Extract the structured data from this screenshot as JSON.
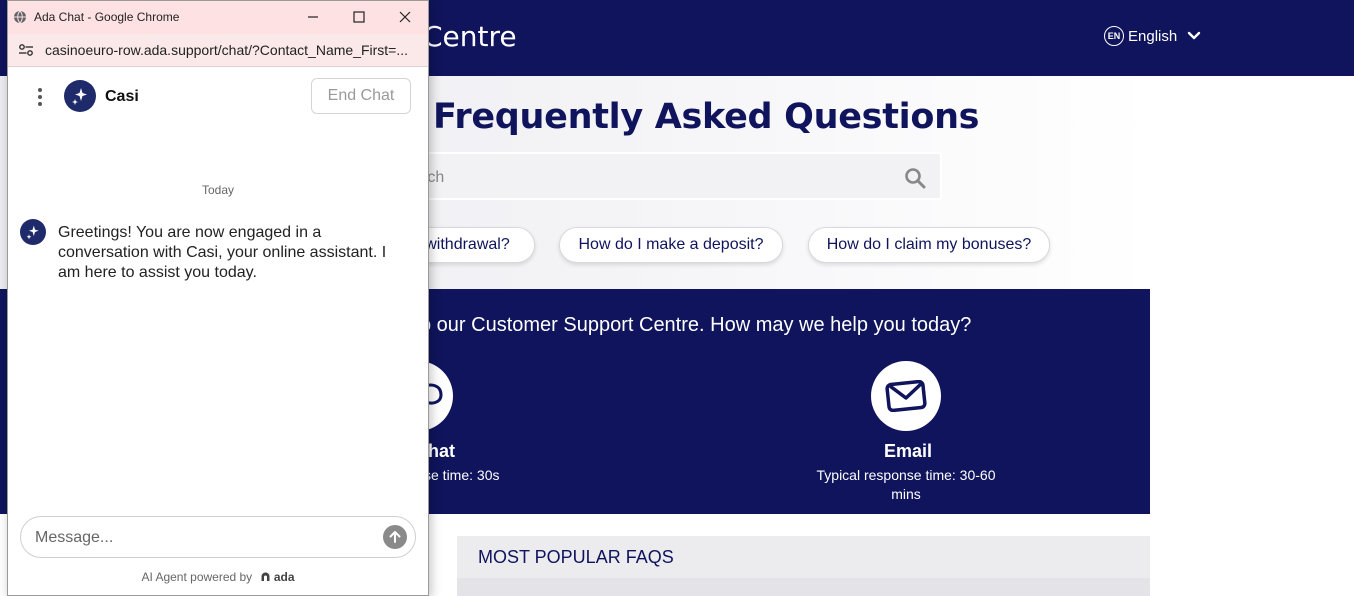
{
  "background_page": {
    "header_title": "Centre",
    "language_badge": "EN",
    "language_label": "English",
    "faq_heading": "Frequently Asked Questions",
    "search_placeholder": "rch",
    "chips": [
      "withdrawal?",
      "How do I make a deposit?",
      "How do I claim my bonuses?"
    ],
    "welcome_text": "o our Customer Support Centre. How may we help you today?",
    "chat_channel": {
      "title": "hat",
      "subtitle": "se time: 30s"
    },
    "email_channel": {
      "title": "Email",
      "subtitle_line1": "Typical response time: 30-60",
      "subtitle_line2": "mins"
    },
    "popular_faqs_label": "MOST POPULAR FAQS",
    "colors": {
      "navy": "#0f145c"
    }
  },
  "window": {
    "title": "Ada Chat - Google Chrome",
    "url": "casinoeuro-row.ada.support/chat/?Contact_Name_First=..."
  },
  "chat": {
    "bot_name": "Casi",
    "end_chat_label": "End Chat",
    "date_divider": "Today",
    "greeting": "Greetings! You are now engaged in a conversation with Casi, your online assistant. I am here to assist you today.",
    "message_placeholder": "Message...",
    "powered_by": "AI Agent powered by",
    "powered_brand": "ada"
  }
}
